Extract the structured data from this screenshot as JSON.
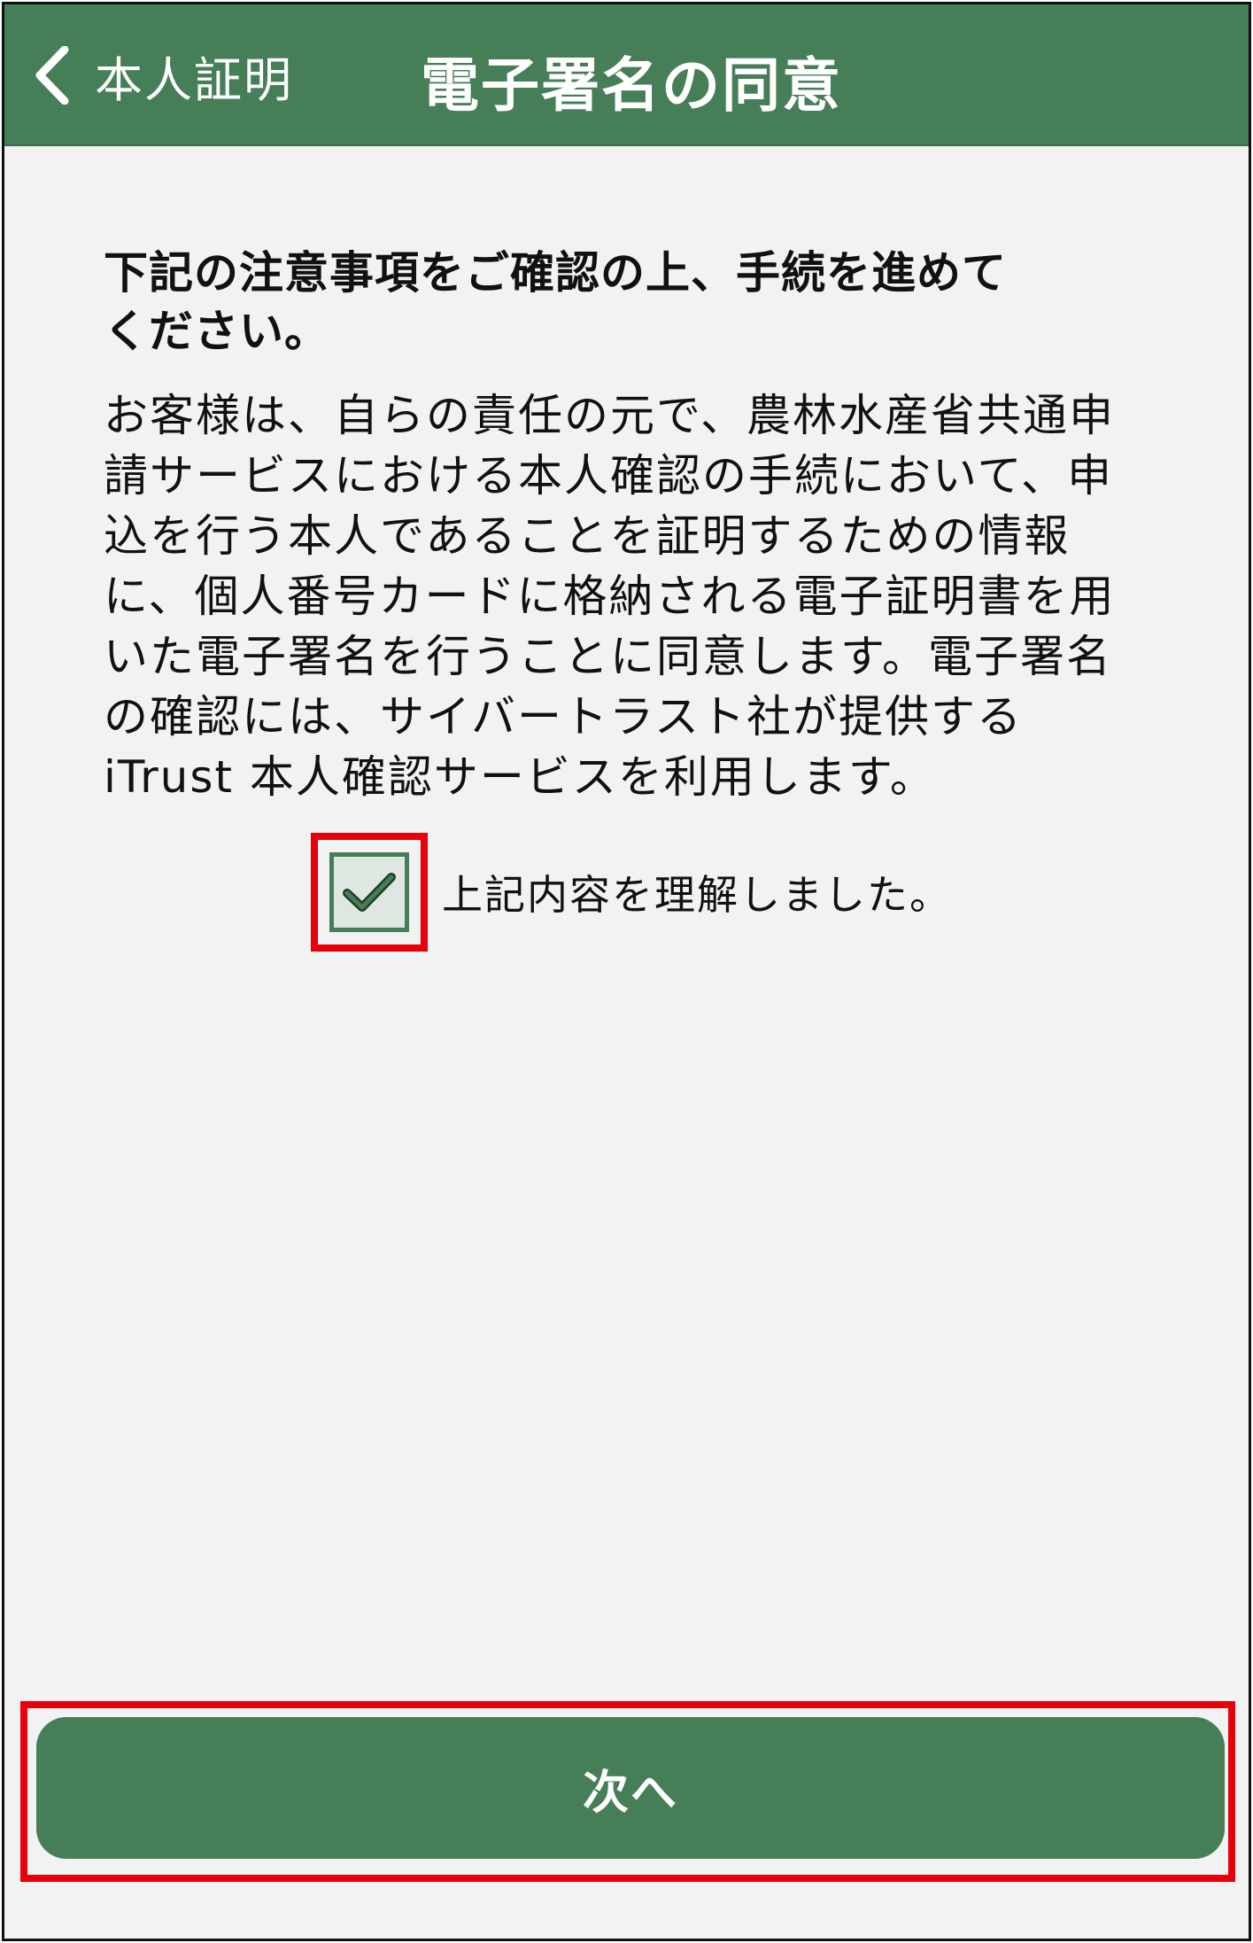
{
  "header": {
    "back_label": "本人証明",
    "title": "電子署名の同意"
  },
  "notice": {
    "heading_line1": "下記の注意事項をご確認の上、手続を進めて",
    "heading_line2": "ください。",
    "body_lines": [
      "お客様は、自らの責任の元で、農林水産省共通申",
      "請サービスにおける本人確認の手続において、申",
      "込を行う本人であることを証明するための情報",
      "に、個人番号カードに格納される電子証明書を用",
      "いた電子署名を行うことに同意します。電子署名",
      "の確認には、サイバートラスト社が提供する",
      "iTrust 本人確認サービスを利用します。"
    ]
  },
  "agreement": {
    "label": "上記内容を理解しました。",
    "checked": true
  },
  "footer": {
    "next_label": "次へ"
  },
  "colors": {
    "header_green": "#467e58",
    "background": "#f2f2f2",
    "highlight_red": "#e8000a"
  }
}
